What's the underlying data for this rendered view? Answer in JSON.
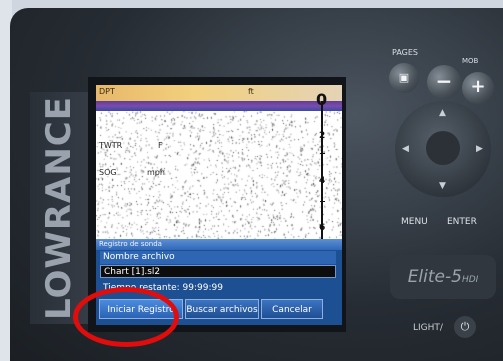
{
  "device": {
    "brand": "LOWRANCE",
    "model": "Elite-5",
    "model_suffix": "HDI"
  },
  "keypad": {
    "pages_label": "PAGES",
    "mob_label": "MOB",
    "minus_label": "−",
    "plus_label": "+",
    "menu_label": "MENU",
    "enter_label": "ENTER",
    "light_label": "LIGHT/",
    "power_symbol": "⏻",
    "icons": [
      "pages-icon",
      "minus-icon",
      "plus-icon",
      "arrow-up-icon",
      "arrow-down-icon",
      "arrow-left-icon",
      "arrow-right-icon",
      "power-icon"
    ]
  },
  "screen": {
    "data_bar": {
      "label": "DPT",
      "unit": "ft"
    },
    "fields": [
      {
        "label": "TWTR",
        "unit": "F"
      },
      {
        "label": "SOG",
        "unit": "mph"
      }
    ],
    "depth_scale": [
      "0",
      "2",
      "4",
      "6"
    ],
    "colors": {
      "header": "#f2d07d",
      "surface": "#6c46a6",
      "dialog": "#1d4f93"
    }
  },
  "dialog": {
    "title": "Registro de sonda",
    "filename_label": "Nombre archivo",
    "filename_value": "Chart [1].sl2",
    "time_text": "Tiempo restante: 99:99:99",
    "buttons": {
      "start": "Iniciar Registro",
      "search": "Buscar archivos",
      "cancel": "Cancelar"
    }
  },
  "annotation": {
    "color": "#e10d0d",
    "target": "Iniciar Registro"
  }
}
